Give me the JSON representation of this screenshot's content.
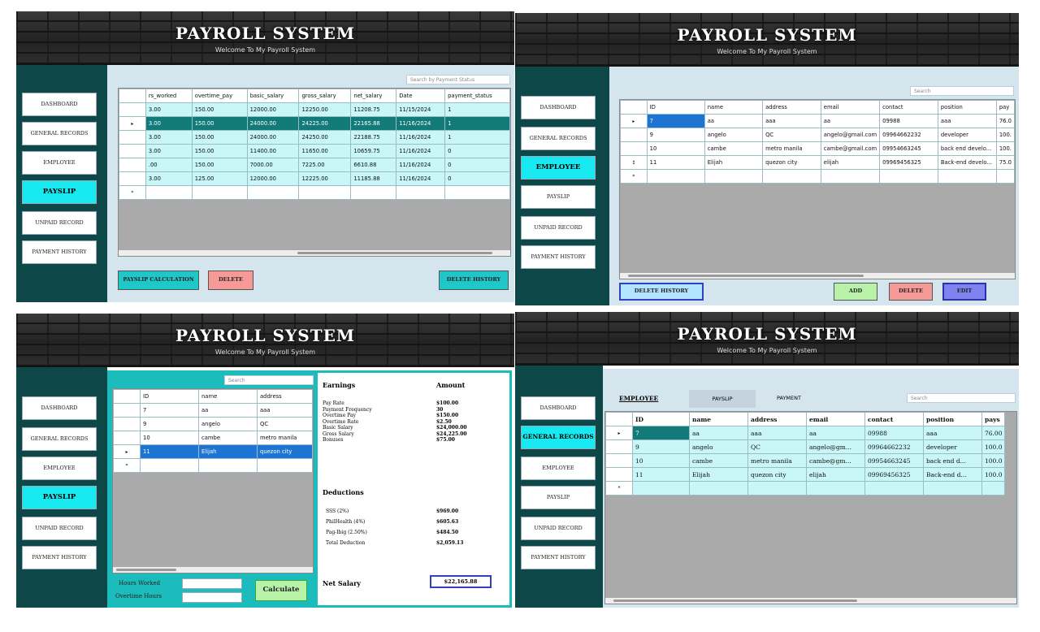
{
  "app": {
    "title": "PAYROLL SYSTEM",
    "subtitle": "Welcome To My Payroll System"
  },
  "nav": {
    "dashboard": "DASHBOARD",
    "general_records": "GENERAL RECORDS",
    "employee": "EMPLOYEE",
    "payslip": "PAYSLIP",
    "unpaid_record": "UNPAID RECORD",
    "payment_history": "PAYMENT HISTORY"
  },
  "payslip_screen": {
    "search_placeholder": "Search by Payment Status",
    "columns": [
      "rs_worked",
      "overtime_pay",
      "basic_salary",
      "gross_salary",
      "net_salary",
      "Date",
      "payment_status"
    ],
    "rows": [
      [
        "3.00",
        "150.00",
        "12000.00",
        "12250.00",
        "11208.75",
        "11/15/2024",
        "1"
      ],
      [
        "3.00",
        "150.00",
        "24000.00",
        "24225.00",
        "22165.88",
        "11/16/2024",
        "1"
      ],
      [
        "3.00",
        "150.00",
        "24000.00",
        "24250.00",
        "22188.75",
        "11/16/2024",
        "1"
      ],
      [
        "3.00",
        "150.00",
        "11400.00",
        "11650.00",
        "10659.75",
        "11/16/2024",
        "0"
      ],
      [
        ".00",
        "150.00",
        "7000.00",
        "7225.00",
        "6610.88",
        "11/16/2024",
        "0"
      ],
      [
        "3.00",
        "125.00",
        "12000.00",
        "12225.00",
        "11185.88",
        "11/16/2024",
        "0"
      ]
    ],
    "buttons": {
      "calc": "PAYSLIP CALCULATION",
      "delete": "DELETE",
      "delete_history": "DELETE HISTORY"
    }
  },
  "employee_screen": {
    "search_placeholder": "Search",
    "columns": [
      "ID",
      "name",
      "address",
      "email",
      "contact",
      "position",
      "pay"
    ],
    "rows": [
      [
        "7",
        "aa",
        "aaa",
        "aa",
        "09988",
        "aaa",
        "76.0"
      ],
      [
        "9",
        "angelo",
        "QC",
        "angelo@gmail.com",
        "09964662232",
        "developer",
        "100."
      ],
      [
        "10",
        "cambe",
        "metro manila",
        "cambe@gmail.com",
        "09954663245",
        "back end develo...",
        "100."
      ],
      [
        "11",
        "Elijah",
        "quezon city",
        "elijah",
        "09969456325",
        "Back-end develo...",
        "75.0"
      ]
    ],
    "buttons": {
      "delete_history": "DELETE HISTORY",
      "add": "ADD",
      "delete": "DELETE",
      "edit": "EDIT"
    }
  },
  "calc_screen": {
    "search_placeholder": "Search",
    "columns": [
      "ID",
      "name",
      "address"
    ],
    "rows": [
      [
        "7",
        "aa",
        "aaa"
      ],
      [
        "9",
        "angelo",
        "QC"
      ],
      [
        "10",
        "cambe",
        "metro manila"
      ],
      [
        "11",
        "Elijah",
        "quezon city"
      ]
    ],
    "hours_worked_label": "Hours Worked",
    "overtime_hours_label": "Overtime Hours",
    "calculate": "Calculate",
    "earnings_header": "Earnings",
    "amount_header": "Amount",
    "earnings": [
      [
        "Pay Rate",
        "$100.00"
      ],
      [
        "Payment Frequency",
        "30"
      ],
      [
        "Overtime Pay",
        "$150.00"
      ],
      [
        "Overtime Rate",
        "$2.50"
      ],
      [
        "Basic Salary",
        "$24,000.00"
      ],
      [
        "Gross Salary",
        "$24,225.00"
      ],
      [
        "Bonuses",
        "$75.00"
      ]
    ],
    "deductions_header": "Deductions",
    "deductions": [
      [
        "SSS (2%)",
        "$969.00"
      ],
      [
        "PhilHealth (4%)",
        "$605.63"
      ],
      [
        "Pag-Ibig (2.50%)",
        "$484.50"
      ],
      [
        "Total Deduction",
        "$2,059.13"
      ]
    ],
    "net_salary_label": "Net Salary",
    "net_salary_value": "$22,165.88"
  },
  "general_screen": {
    "tabs": [
      "EMPLOYEE",
      "PAYSLIP",
      "PAYMENT"
    ],
    "search_placeholder": "Search",
    "columns": [
      "ID",
      "name",
      "address",
      "email",
      "contact",
      "position",
      "pays"
    ],
    "rows": [
      [
        "7",
        "aa",
        "aaa",
        "aa",
        "09988",
        "aaa",
        "76.00"
      ],
      [
        "9",
        "angelo",
        "QC",
        "angelo@gm...",
        "09964662232",
        "developer",
        "100.0"
      ],
      [
        "10",
        "cambe",
        "metro manila",
        "cambe@gm...",
        "09954663245",
        "back end d...",
        "100.0"
      ],
      [
        "11",
        "Elijah",
        "quezon city",
        "elijah",
        "09969456325",
        "Back-end d...",
        "100.0"
      ]
    ]
  },
  "colors": {
    "sidebar": "#0e4747",
    "active_nav": "#18e8f0",
    "row": "#c9f6f7",
    "selected_row": "#127a78",
    "content_bg": "#d5e5ee"
  }
}
